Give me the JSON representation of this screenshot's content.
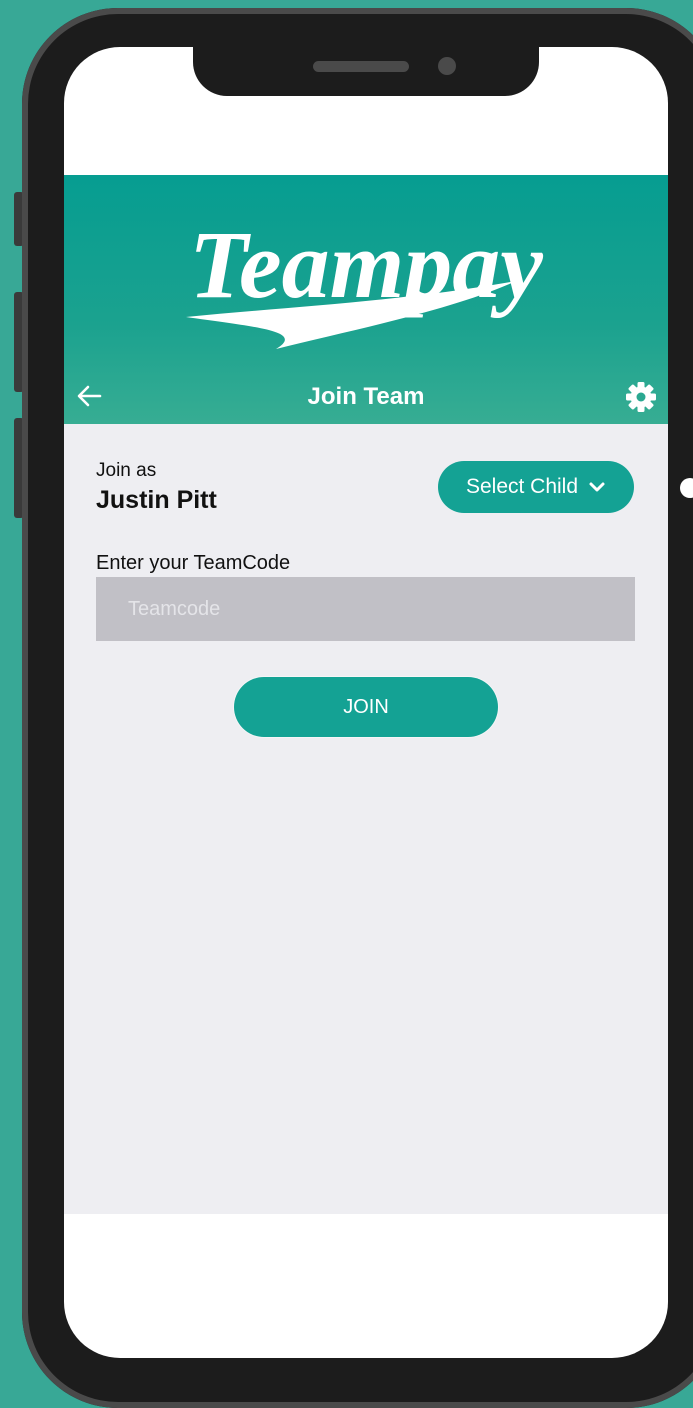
{
  "header": {
    "logo_text": "Teampay",
    "title": "Join Team",
    "back_icon": "arrow-left-icon",
    "settings_icon": "gear-icon"
  },
  "join": {
    "label": "Join as",
    "name": "Justin Pitt",
    "select_child_label": "Select Child",
    "select_child_icon": "chevron-down-icon"
  },
  "teamcode": {
    "label": "Enter your TeamCode",
    "placeholder": "Teamcode",
    "value": ""
  },
  "actions": {
    "join_label": "JOIN"
  },
  "colors": {
    "accent": "#14a294",
    "header_top": "#069d91",
    "header_bottom": "#37ad93",
    "background": "#38a896",
    "content_bg": "#eeeef2",
    "input_bg": "#c1c0c6"
  }
}
